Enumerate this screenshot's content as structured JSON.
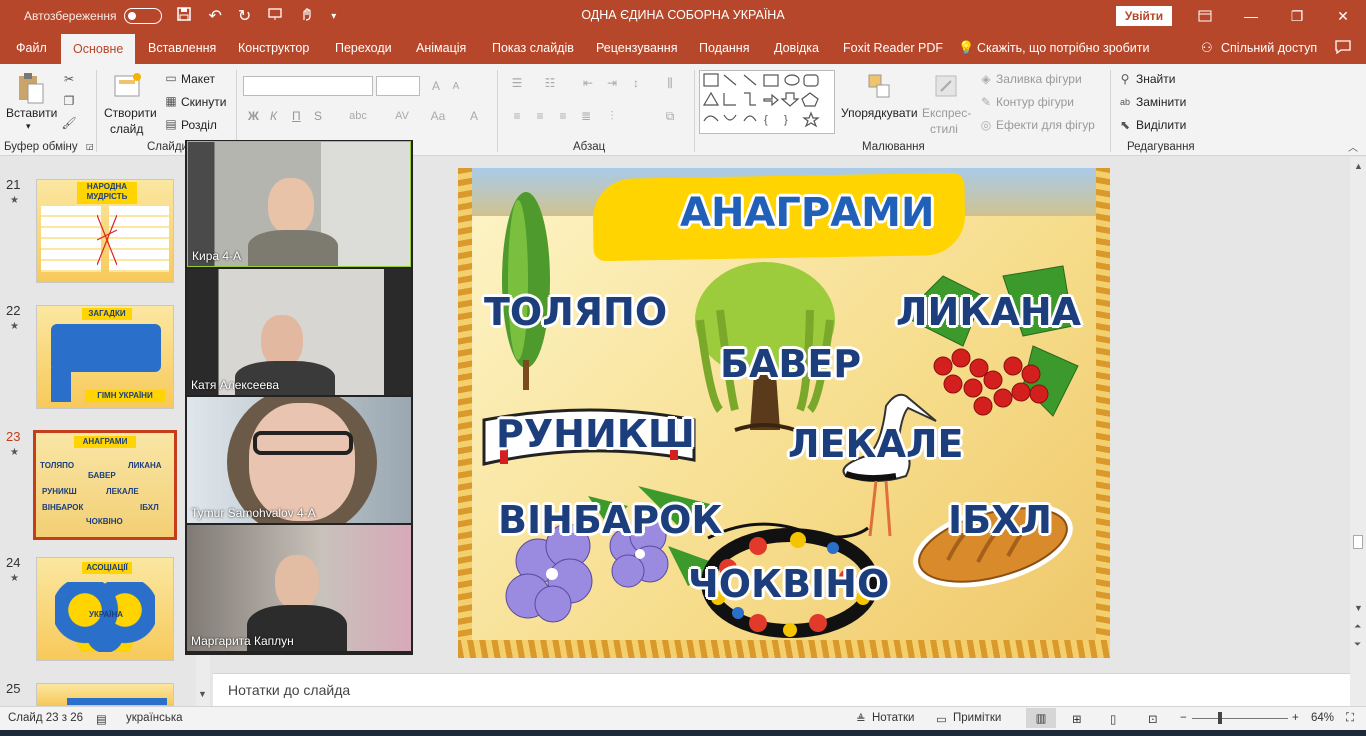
{
  "titlebar": {
    "autosave_label": "Автозбереження",
    "doc_title": "ОДНА ЄДИНА СОБОРНА УКРАЇНА",
    "signin_label": "Увійти",
    "accent": "#b7472a"
  },
  "tabs": [
    "Файл",
    "Основне",
    "Вставлення",
    "Конструктор",
    "Переходи",
    "Анімація",
    "Показ слайдів",
    "Рецензування",
    "Подання",
    "Довідка",
    "Foxit Reader PDF",
    "Скажіть, що потрібно зробити",
    "Спільний доступ"
  ],
  "ribbon": {
    "paste": "Вставити",
    "clipboard_group": "Буфер обміну",
    "new_slide_line1": "Створити",
    "new_slide_line2": "слайд",
    "layout": "Макет",
    "reset": "Скинути",
    "section": "Розділ",
    "slides_group": "Слайди",
    "bold": "Ж",
    "italic": "К",
    "underline": "П",
    "strike": "S",
    "paragraph_group": "Абзац",
    "drawing_group": "Малювання",
    "arrange": "Упорядкувати",
    "quick_styles_line1": "Експрес-",
    "quick_styles_line2": "стилі",
    "shape_fill": "Заливка фігури",
    "shape_outline": "Контур фігури",
    "shape_effects": "Ефекти для фігур",
    "find": "Знайти",
    "replace": "Замінити",
    "select": "Виділити",
    "editing_group": "Редагування"
  },
  "slides": [
    {
      "num": "21",
      "title_line1": "НАРОДНА",
      "title_line2": "МУДРІСТЬ"
    },
    {
      "num": "22",
      "title": "ЗАГАДКИ",
      "footer": "ГІМН УКРАЇНИ"
    },
    {
      "num": "23",
      "title": "АНАГРАМИ"
    },
    {
      "num": "24",
      "title": "АСОЦІАЦІЇ",
      "center": "УКРАЇНА"
    },
    {
      "num": "25"
    }
  ],
  "participants": [
    {
      "name": "Кира 4-А"
    },
    {
      "name": "Катя Алексеева"
    },
    {
      "name": "Tymur Samohvalov 4-A"
    },
    {
      "name": "Маргарита Каплун"
    }
  ],
  "slide": {
    "title": "АНАГРАМИ",
    "words": [
      "ТОЛЯПО",
      "БАВЕР",
      "ЛИКАНА",
      "РУНИКШ",
      "ЛЕКАЛЕ",
      "ВІНБАРОК",
      "ІБХЛ",
      "ЧОКВІНО"
    ]
  },
  "notes_placeholder": "Нотатки до слайда",
  "status": {
    "slide_of": "Слайд 23 з 26",
    "language": "українська",
    "notes": "Нотатки",
    "comments": "Примітки",
    "zoom": "64%"
  }
}
